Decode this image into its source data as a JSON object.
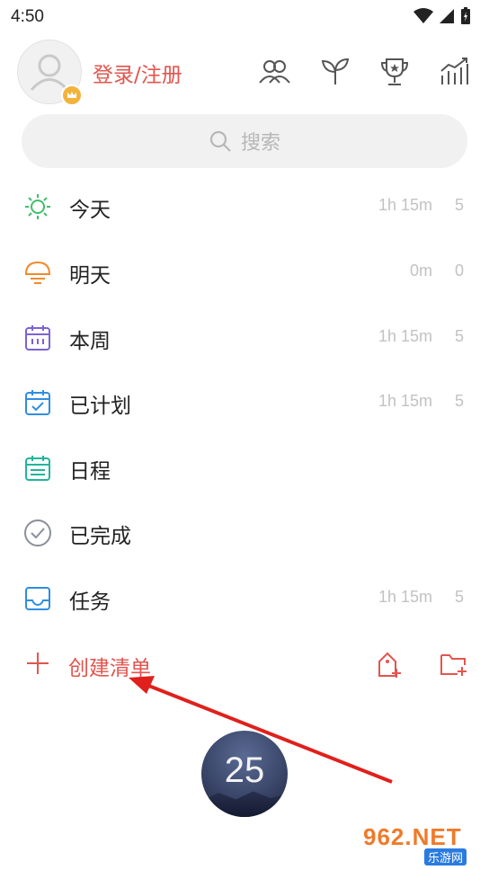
{
  "status_bar": {
    "time": "4:50"
  },
  "header": {
    "login_label": "登录/注册",
    "icons": [
      "people-icon",
      "sprout-icon",
      "trophy-icon",
      "stats-icon"
    ]
  },
  "search": {
    "placeholder": "搜索"
  },
  "lists": [
    {
      "name": "today",
      "label": "今天",
      "time": "1h 15m",
      "count": "5",
      "icon": "sun-icon",
      "color": "#3fbf6a"
    },
    {
      "name": "tomorrow",
      "label": "明天",
      "time": "0m",
      "count": "0",
      "icon": "sunset-icon",
      "color": "#f08a2b"
    },
    {
      "name": "this-week",
      "label": "本周",
      "time": "1h 15m",
      "count": "5",
      "icon": "calendar-week-icon",
      "color": "#7b62d6"
    },
    {
      "name": "planned",
      "label": "已计划",
      "time": "1h 15m",
      "count": "5",
      "icon": "calendar-check-icon",
      "color": "#2f8ee0"
    },
    {
      "name": "schedule",
      "label": "日程",
      "time": "",
      "count": "",
      "icon": "calendar-list-icon",
      "color": "#20b59b"
    },
    {
      "name": "completed",
      "label": "已完成",
      "time": "",
      "count": "",
      "icon": "check-circle-icon",
      "color": "#8a8f99"
    },
    {
      "name": "tasks",
      "label": "任务",
      "time": "1h 15m",
      "count": "5",
      "icon": "inbox-icon",
      "color": "#2f8ee0"
    }
  ],
  "create": {
    "label": "创建清单"
  },
  "pomodoro": {
    "number": "25"
  },
  "watermark": {
    "top": "962.NET",
    "bottom": "乐游网"
  },
  "colors": {
    "accent": "#e2554e",
    "muted": "#c2c2c2",
    "search_bg": "#f1f1f1"
  }
}
